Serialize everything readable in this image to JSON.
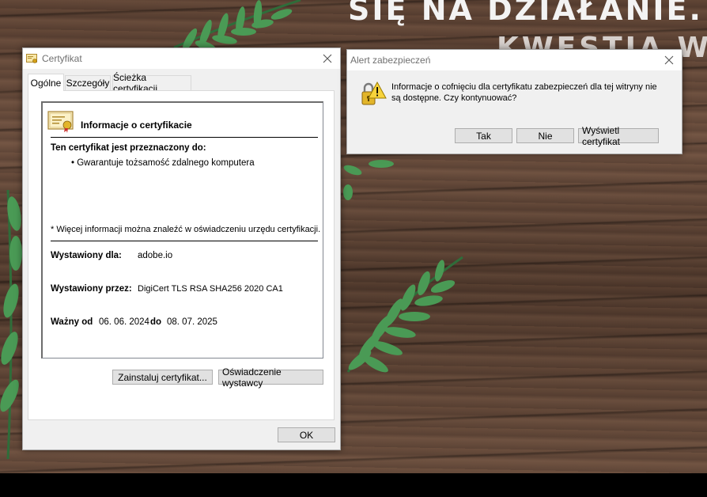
{
  "background": {
    "headline": "SIĘ NA DZIAŁANIE.",
    "headline2": "KWESTIA W"
  },
  "cert_window": {
    "title": "Certyfikat",
    "tabs": [
      {
        "label": "Ogólne"
      },
      {
        "label": "Szczegóły"
      },
      {
        "label": "Ścieżka certyfikacji"
      }
    ],
    "info_title": "Informacje o certyfikacie",
    "purpose_heading": "Ten certyfikat jest przeznaczony do:",
    "purpose_item": "Gwarantuje tożsamość zdalnego komputera",
    "more_info": "* Więcej informacji można znaleźć w oświadczeniu urzędu certyfikacji.",
    "issued_to_label": "Wystawiony dla:",
    "issued_to_value": "adobe.io",
    "issued_by_label": "Wystawiony przez:",
    "issued_by_value": "DigiCert TLS RSA SHA256 2020 CA1",
    "valid_from_label": "Ważny od",
    "valid_from_value": "06. 06. 2024",
    "valid_to_label": "do",
    "valid_to_value": "08. 07. 2025",
    "install_button": "Zainstaluj certyfikat...",
    "statement_button": "Oświadczenie wystawcy",
    "ok_button": "OK"
  },
  "alert_window": {
    "title": "Alert zabezpieczeń",
    "message_line1": "Informacje o cofnięciu dla certyfikatu zabezpieczeń dla tej witryny nie",
    "message_line2": "są dostępne. Czy kontynuować?",
    "yes_button": "Tak",
    "no_button": "Nie",
    "view_button": "Wyświetl certyfikat"
  },
  "colors": {
    "window_bg": "#f0f0f0",
    "titlebar_bg": "#ffffff",
    "button_bg": "#e1e1e1",
    "button_border": "#adadad",
    "fern_green": "#3f8a4a"
  }
}
